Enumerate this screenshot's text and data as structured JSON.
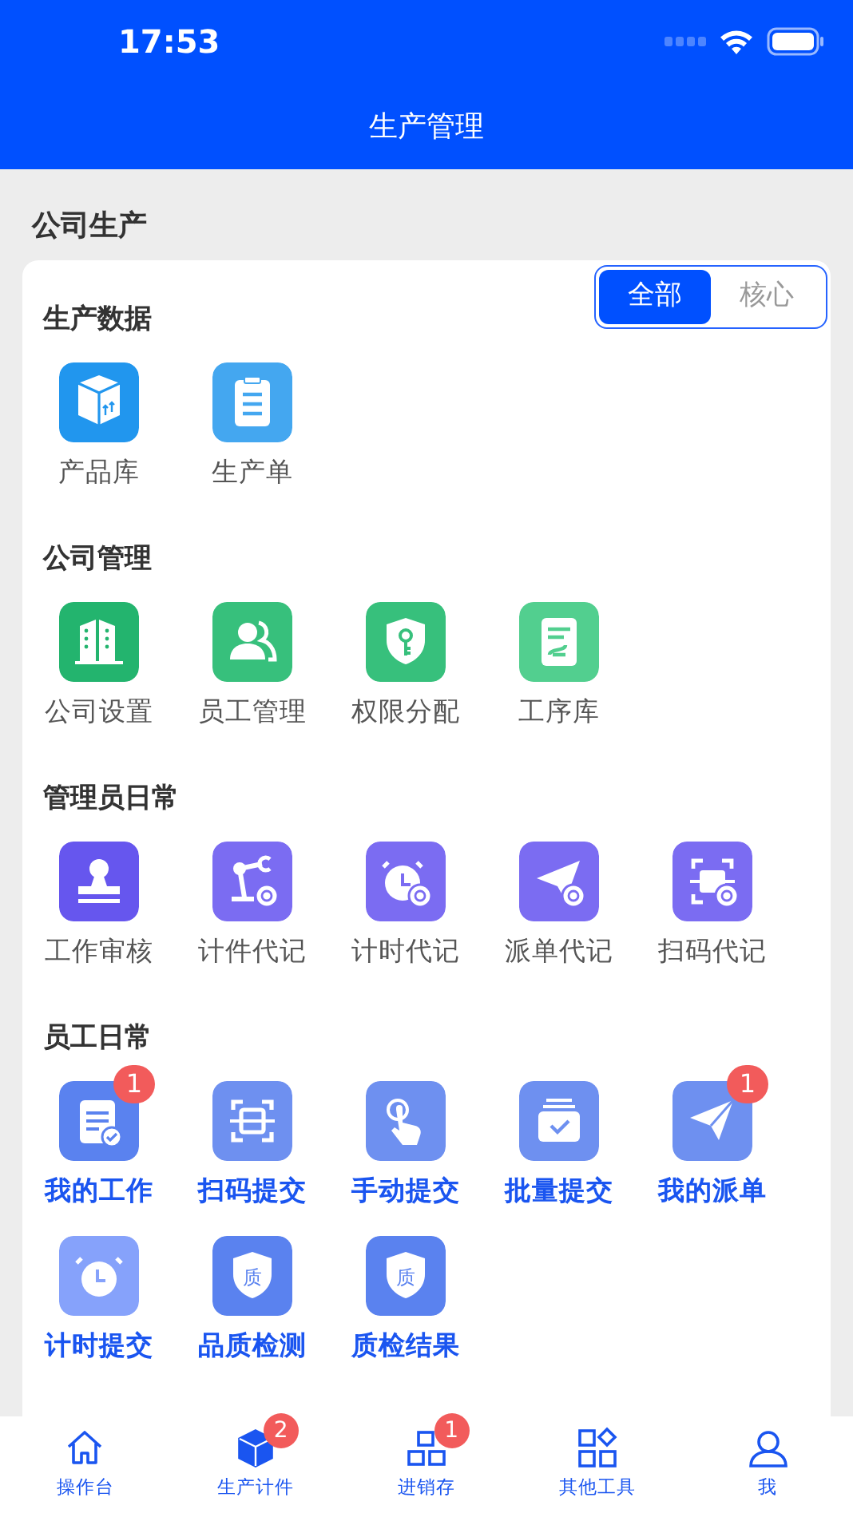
{
  "status_bar": {
    "time": "17:53"
  },
  "header": {
    "title": "生产管理"
  },
  "section_title": "公司生产",
  "filter": [
    {
      "label": "全部",
      "selected": true
    },
    {
      "label": "核心",
      "selected": false
    }
  ],
  "groups": [
    {
      "title": "生产数据",
      "items": [
        {
          "label": "产品库",
          "kind": "box",
          "color": "#2196ee",
          "highlight": false
        },
        {
          "label": "生产单",
          "kind": "clipboard",
          "color": "#44a7f0",
          "highlight": false
        }
      ]
    },
    {
      "title": "公司管理",
      "items": [
        {
          "label": "公司设置",
          "kind": "building",
          "color": "#23b46e",
          "highlight": false
        },
        {
          "label": "员工管理",
          "kind": "people",
          "color": "#37c07c",
          "highlight": false
        },
        {
          "label": "权限分配",
          "kind": "shield-key",
          "color": "#37c07c",
          "highlight": false
        },
        {
          "label": "工序库",
          "kind": "doc",
          "color": "#52cf8f",
          "highlight": false
        }
      ]
    },
    {
      "title": "管理员日常",
      "items": [
        {
          "label": "工作审核",
          "kind": "stamp",
          "color": "#6656ee",
          "highlight": false
        },
        {
          "label": "计件代记",
          "kind": "robot-arm",
          "color": "#7b6cf2",
          "highlight": false
        },
        {
          "label": "计时代记",
          "kind": "alarm-proxy",
          "color": "#7b6cf2",
          "highlight": false
        },
        {
          "label": "派单代记",
          "kind": "plane-proxy",
          "color": "#7b6cf2",
          "highlight": false
        },
        {
          "label": "扫码代记",
          "kind": "scan-proxy",
          "color": "#7b6cf2",
          "highlight": false
        }
      ]
    },
    {
      "title": "员工日常",
      "items": [
        {
          "label": "我的工作",
          "kind": "task",
          "color": "#5a82ef",
          "highlight": true,
          "badge": "1"
        },
        {
          "label": "扫码提交",
          "kind": "scan",
          "color": "#6e90f0",
          "highlight": true
        },
        {
          "label": "手动提交",
          "kind": "tap",
          "color": "#6e90f0",
          "highlight": true
        },
        {
          "label": "批量提交",
          "kind": "batch",
          "color": "#6e90f0",
          "highlight": true
        },
        {
          "label": "我的派单",
          "kind": "plane",
          "color": "#6e90f0",
          "highlight": true,
          "badge": "1"
        },
        {
          "label": "计时提交",
          "kind": "alarm",
          "color": "#86a2fb",
          "highlight": true
        },
        {
          "label": "品质检测",
          "kind": "quality",
          "color": "#5a82ef",
          "highlight": true,
          "glyph": "质"
        },
        {
          "label": "质检结果",
          "kind": "quality",
          "color": "#5a82ef",
          "highlight": true,
          "glyph": "质"
        }
      ]
    }
  ],
  "tab_bar": [
    {
      "label": "操作台",
      "kind": "home",
      "selected": false
    },
    {
      "label": "生产计件",
      "kind": "cube",
      "selected": true,
      "badge": "2"
    },
    {
      "label": "进销存",
      "kind": "blocks",
      "selected": false,
      "badge": "1"
    },
    {
      "label": "其他工具",
      "kind": "grid",
      "selected": false
    },
    {
      "label": "我",
      "kind": "user",
      "selected": false
    }
  ]
}
